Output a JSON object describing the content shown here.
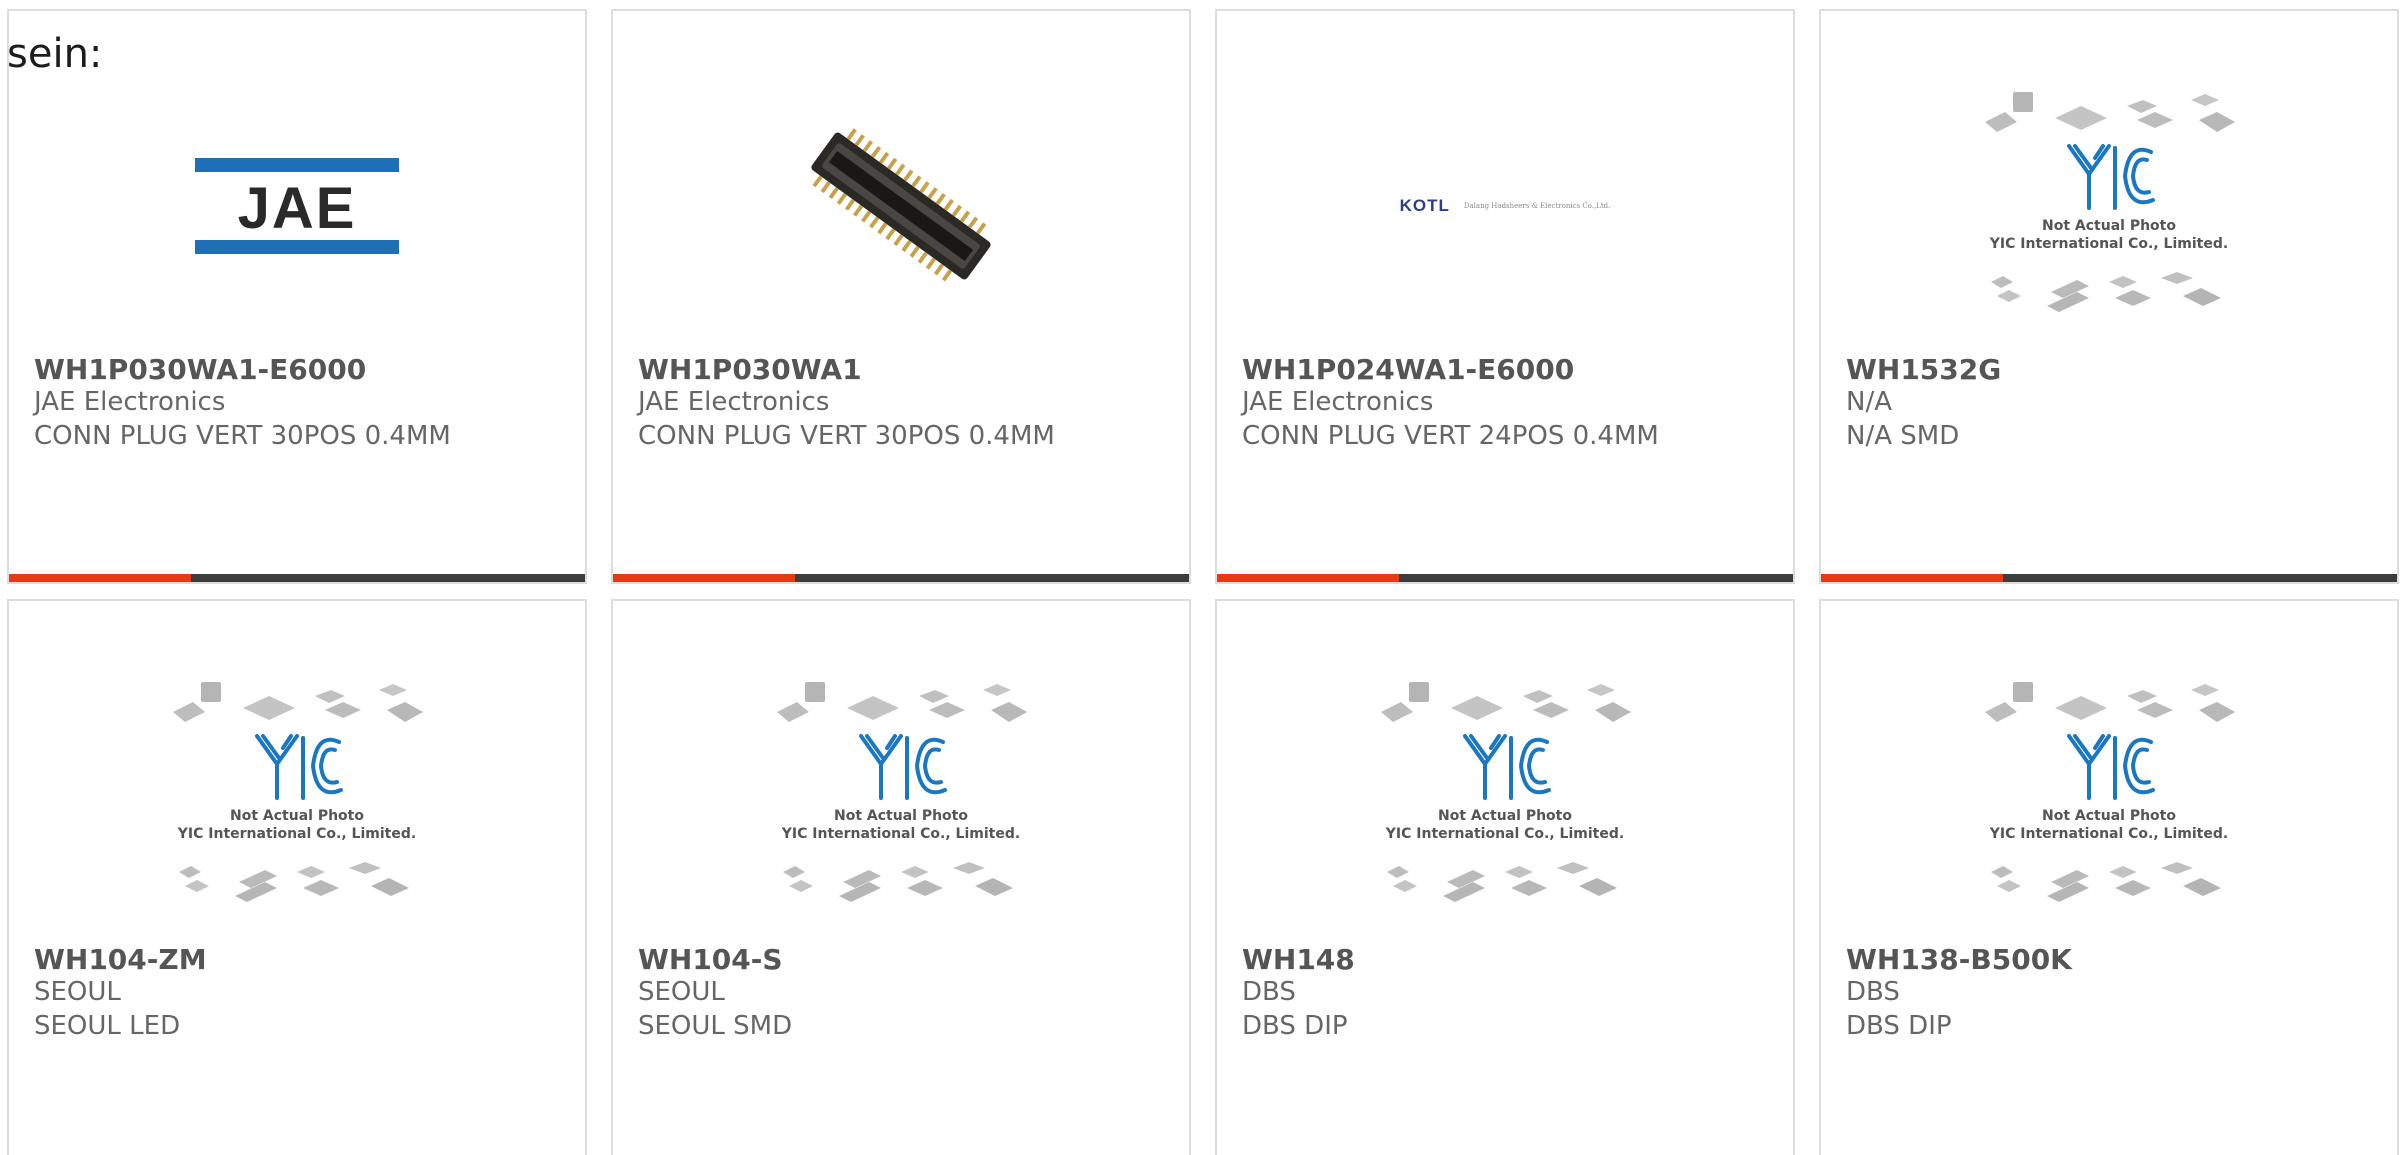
{
  "intro_text": "sein:",
  "colors": {
    "accent_bar": "#e83a12",
    "dark_bar": "#3d3d3d",
    "yic_blue": "#1a78c2"
  },
  "placeholder_image": {
    "line1": "Not Actual Photo",
    "line2": "YIC International Co., Limited."
  },
  "jae_logo_text": "JAE",
  "kotl_logo": {
    "mark": "KOTL",
    "subtitle": "Dalang Hadsheers & Electronics Co.,Ltd."
  },
  "products": [
    {
      "part": "WH1P030WA1-E6000",
      "maker": "JAE Electronics",
      "desc": "CONN PLUG VERT 30POS 0.4MM",
      "image": "jae-logo"
    },
    {
      "part": "WH1P030WA1",
      "maker": "JAE Electronics",
      "desc": "CONN PLUG VERT 30POS 0.4MM",
      "image": "connector-photo"
    },
    {
      "part": "WH1P024WA1-E6000",
      "maker": "JAE Electronics",
      "desc": "CONN PLUG VERT 24POS 0.4MM",
      "image": "kotl-logo"
    },
    {
      "part": "WH1532G",
      "maker": "N/A",
      "desc": "N/A SMD",
      "image": "placeholder"
    },
    {
      "part": "WH104-ZM",
      "maker": "SEOUL",
      "desc": "SEOUL LED",
      "image": "placeholder"
    },
    {
      "part": "WH104-S",
      "maker": "SEOUL",
      "desc": "SEOUL SMD",
      "image": "placeholder"
    },
    {
      "part": "WH148",
      "maker": "DBS",
      "desc": "DBS DIP",
      "image": "placeholder"
    },
    {
      "part": "WH138-B500K",
      "maker": "DBS",
      "desc": "DBS DIP",
      "image": "placeholder"
    }
  ]
}
